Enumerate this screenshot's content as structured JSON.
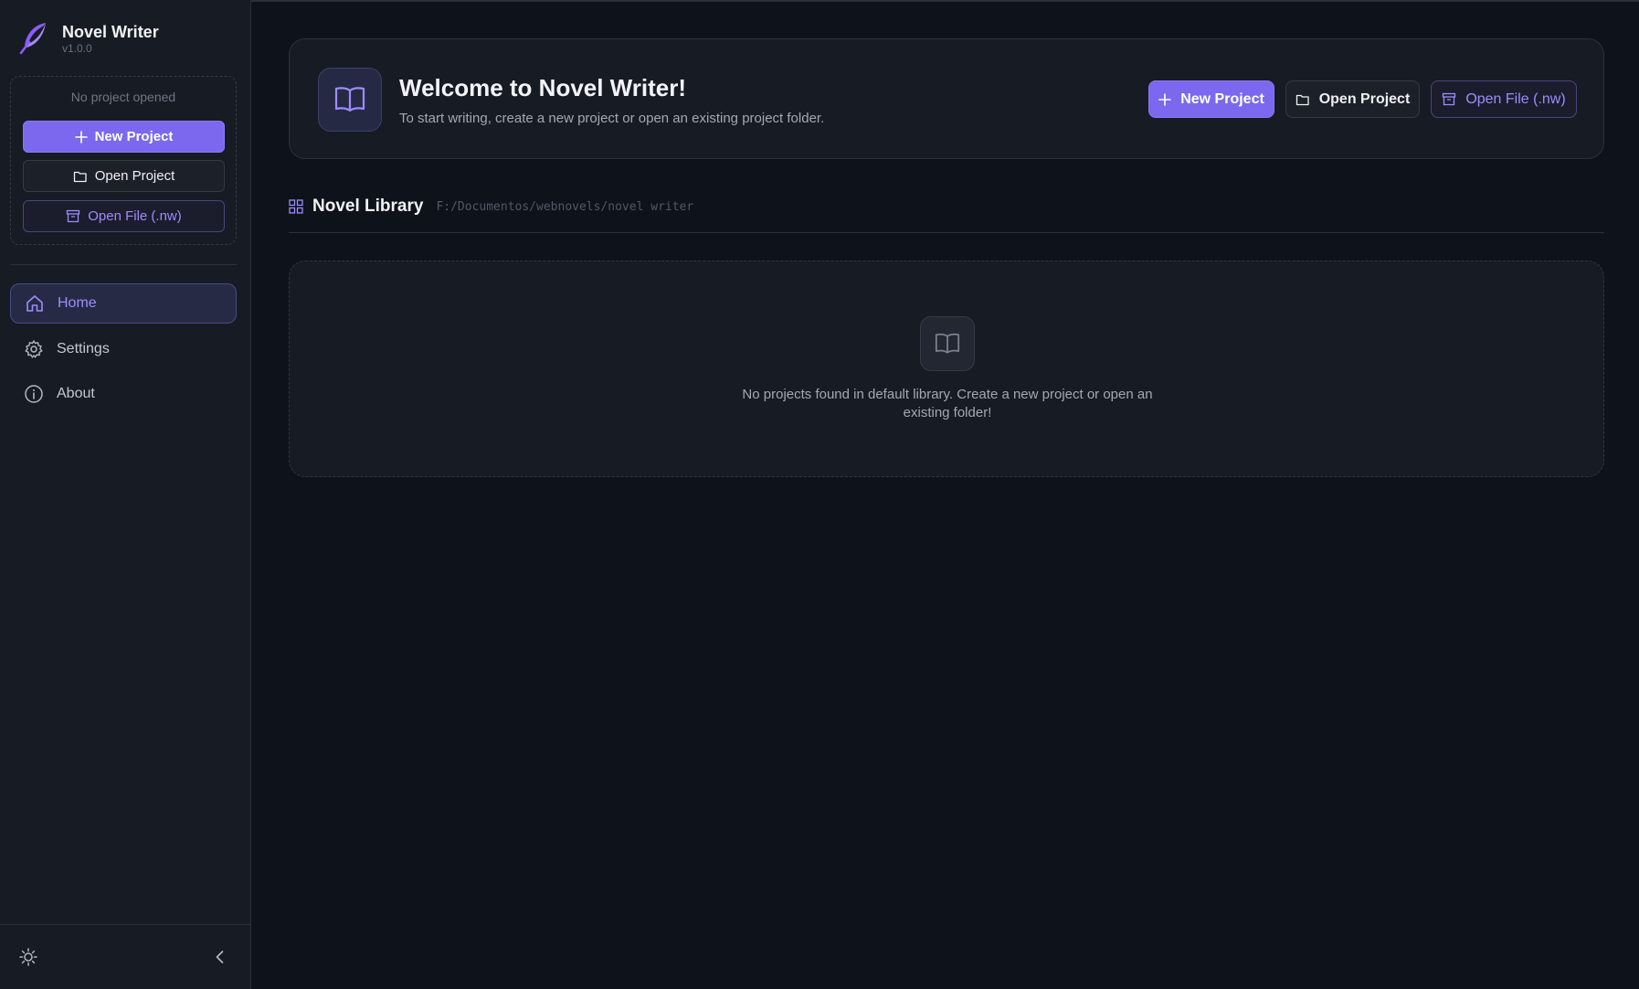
{
  "app": {
    "title": "Novel Writer",
    "version": "v1.0.0"
  },
  "sidebar": {
    "project_status": "No project opened",
    "buttons": {
      "new_project": "New Project",
      "open_project": "Open Project",
      "open_file": "Open File (.nw)"
    },
    "nav": [
      {
        "label": "Home",
        "icon": "home-icon",
        "active": true
      },
      {
        "label": "Settings",
        "icon": "gear-icon",
        "active": false
      },
      {
        "label": "About",
        "icon": "info-icon",
        "active": false
      }
    ],
    "footer": {
      "theme_icon": "sun-icon",
      "collapse_icon": "chevron-left-icon"
    }
  },
  "welcome": {
    "title": "Welcome to Novel Writer!",
    "subtitle": "To start writing, create a new project or open an existing project folder.",
    "buttons": {
      "new_project": "New Project",
      "open_project": "Open Project",
      "open_file": "Open File (.nw)"
    }
  },
  "library": {
    "title": "Novel Library",
    "path": "F:/Documentos/webnovels/novel writer",
    "empty_message": "No projects found in default library. Create a new project or open an existing folder!"
  },
  "colors": {
    "accent": "#7c68ee",
    "accent_text": "#9d8cff",
    "background": "#0e121a",
    "panel": "#171b23"
  }
}
